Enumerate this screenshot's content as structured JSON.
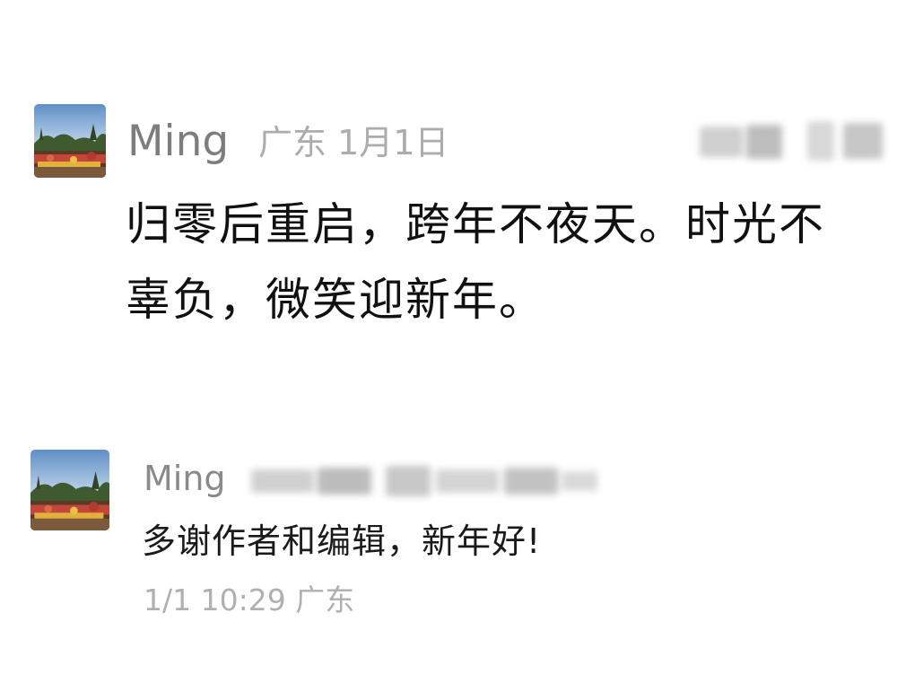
{
  "comment": {
    "author": "Ming",
    "location_date": "广东 1月1日",
    "text_line_1": "归零后重启，跨年不夜天。时光不",
    "text_line_2": "辜负，微笑迎新年。",
    "avatar_icon": "landscape-avatar-icon"
  },
  "reply": {
    "author": "Ming",
    "text": "多谢作者和编辑，新年好!",
    "time_location": "1/1 10:29  广东",
    "avatar_icon": "landscape-avatar-icon"
  },
  "colors": {
    "name": "#7d7d7d",
    "meta": "#acacac",
    "body": "#111111"
  }
}
